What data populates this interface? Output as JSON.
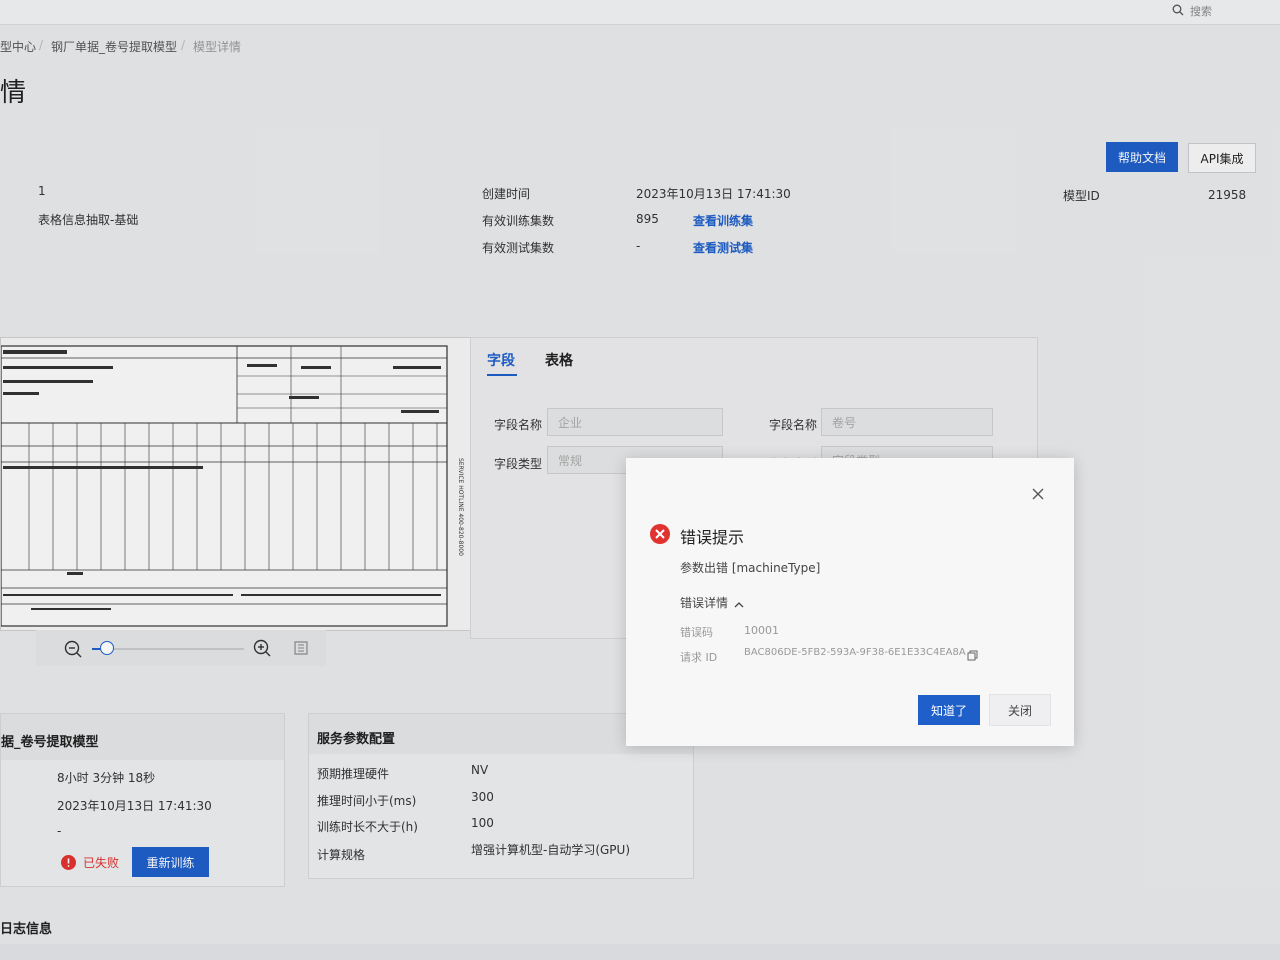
{
  "header": {
    "search_placeholder": "搜索"
  },
  "breadcrumb": {
    "items": [
      "型中心",
      "钢厂单据_卷号提取模型",
      "模型详情"
    ],
    "separator": "/"
  },
  "page": {
    "title": "情"
  },
  "actions": {
    "help_doc": "帮助文档",
    "api_integration": "API集成"
  },
  "info": {
    "col1_value1": "1",
    "col1_value2": "表格信息抽取-基础",
    "created_time_label": "创建时间",
    "created_time_value": "2023年10月13日 17:41:30",
    "train_set_label": "有效训练集数",
    "train_set_value": "895",
    "train_set_link": "查看训练集",
    "test_set_label": "有效测试集数",
    "test_set_value": "-",
    "test_set_link": "查看测试集",
    "model_id_label": "模型ID",
    "model_id_value": "21958"
  },
  "preview": {
    "side_text": "SERVICE HOTLINE 400-820-8000"
  },
  "fields_panel": {
    "tabs": [
      "字段",
      "表格"
    ],
    "field_name_label": "字段名称",
    "field_name_1": "企业",
    "field_name_2": "卷号",
    "field_type_label": "字段类型",
    "field_type_1": "常规",
    "field_type_2": "字段类型"
  },
  "training_card": {
    "title": "据_卷号提取模型",
    "duration": "8小时 3分钟 18秒",
    "time": "2023年10月13日 17:41:30",
    "dash": "-",
    "status": "已失败",
    "retrain": "重新训练"
  },
  "service_card": {
    "title": "服务参数配置",
    "rows": [
      {
        "label": "预期推理硬件",
        "value": "NV"
      },
      {
        "label": "推理时间小于(ms)",
        "value": "300"
      },
      {
        "label": "训练时长不大于(h)",
        "value": "100"
      },
      {
        "label": "计算规格",
        "value": "增强计算机型-自动学习(GPU)"
      }
    ]
  },
  "log": {
    "title": "日志信息"
  },
  "modal": {
    "title": "错误提示",
    "message": "参数出错 [machineType]",
    "details_toggle": "错误详情",
    "error_code_label": "错误码",
    "error_code_value": "10001",
    "request_id_label": "请求 ID",
    "request_id_value": "BAC806DE-5FB2-593A-9F38-6E1E33C4EA8A",
    "ok_button": "知道了",
    "close_button": "关闭"
  },
  "colors": {
    "primary": "#1f5fc9",
    "error": "#e0322f"
  }
}
